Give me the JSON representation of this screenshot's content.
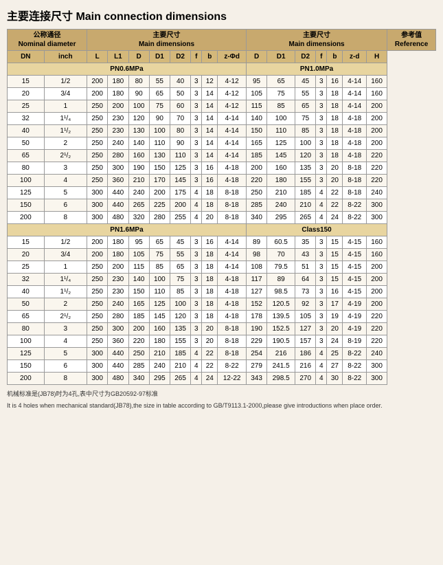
{
  "title": "主要连接尺寸 Main connection dimensions",
  "headers": {
    "nominal_diameter": "公称通径\nNominal diameter",
    "dn": "DN",
    "inch": "inch",
    "main_dimensions": "主要尺寸\nMain dimensions",
    "reference": "参考值\nReference",
    "cols_main": [
      "L",
      "L1",
      "D",
      "D1",
      "D2",
      "f",
      "b",
      "z-Φd"
    ],
    "cols_right": [
      "D",
      "D1",
      "D2",
      "f",
      "b",
      "z-d",
      "H"
    ]
  },
  "sections": [
    {
      "label": "PN0.6MPa",
      "label_right": "PN1.0MPa",
      "rows": [
        {
          "dn": "15",
          "inch": "1/2",
          "L": "200",
          "L1": "180",
          "D": "80",
          "D1": "55",
          "D2": "40",
          "f": "3",
          "b": "12",
          "zpd": "4-12",
          "D_r": "95",
          "D1_r": "65",
          "D2_r": "45",
          "f_r": "3",
          "b_r": "16",
          "zd_r": "4-14",
          "H": "160"
        },
        {
          "dn": "20",
          "inch": "3/4",
          "L": "200",
          "L1": "180",
          "D": "90",
          "D1": "65",
          "D2": "50",
          "f": "3",
          "b": "14",
          "zpd": "4-12",
          "D_r": "105",
          "D1_r": "75",
          "D2_r": "55",
          "f_r": "3",
          "b_r": "18",
          "zd_r": "4-14",
          "H": "160"
        },
        {
          "dn": "25",
          "inch": "1",
          "L": "250",
          "L1": "200",
          "D": "100",
          "D1": "75",
          "D2": "60",
          "f": "3",
          "b": "14",
          "zpd": "4-12",
          "D_r": "115",
          "D1_r": "85",
          "D2_r": "65",
          "f_r": "3",
          "b_r": "18",
          "zd_r": "4-14",
          "H": "200"
        },
        {
          "dn": "32",
          "inch": "1¹/₄",
          "L": "250",
          "L1": "230",
          "D": "120",
          "D1": "90",
          "D2": "70",
          "f": "3",
          "b": "14",
          "zpd": "4-14",
          "D_r": "140",
          "D1_r": "100",
          "D2_r": "75",
          "f_r": "3",
          "b_r": "18",
          "zd_r": "4-18",
          "H": "200"
        },
        {
          "dn": "40",
          "inch": "1¹/₂",
          "L": "250",
          "L1": "230",
          "D": "130",
          "D1": "100",
          "D2": "80",
          "f": "3",
          "b": "14",
          "zpd": "4-14",
          "D_r": "150",
          "D1_r": "110",
          "D2_r": "85",
          "f_r": "3",
          "b_r": "18",
          "zd_r": "4-18",
          "H": "200"
        },
        {
          "dn": "50",
          "inch": "2",
          "L": "250",
          "L1": "240",
          "D": "140",
          "D1": "110",
          "D2": "90",
          "f": "3",
          "b": "14",
          "zpd": "4-14",
          "D_r": "165",
          "D1_r": "125",
          "D2_r": "100",
          "f_r": "3",
          "b_r": "18",
          "zd_r": "4-18",
          "H": "200"
        },
        {
          "dn": "65",
          "inch": "2¹/₂",
          "L": "250",
          "L1": "280",
          "D": "160",
          "D1": "130",
          "D2": "110",
          "f": "3",
          "b": "14",
          "zpd": "4-14",
          "D_r": "185",
          "D1_r": "145",
          "D2_r": "120",
          "f_r": "3",
          "b_r": "18",
          "zd_r": "4-18",
          "H": "220"
        },
        {
          "dn": "80",
          "inch": "3",
          "L": "250",
          "L1": "300",
          "D": "190",
          "D1": "150",
          "D2": "125",
          "f": "3",
          "b": "16",
          "zpd": "4-18",
          "D_r": "200",
          "D1_r": "160",
          "D2_r": "135",
          "f_r": "3",
          "b_r": "20",
          "zd_r": "8-18",
          "H": "220"
        },
        {
          "dn": "100",
          "inch": "4",
          "L": "250",
          "L1": "360",
          "D": "210",
          "D1": "170",
          "D2": "145",
          "f": "3",
          "b": "16",
          "zpd": "4-18",
          "D_r": "220",
          "D1_r": "180",
          "D2_r": "155",
          "f_r": "3",
          "b_r": "20",
          "zd_r": "8-18",
          "H": "220"
        },
        {
          "dn": "125",
          "inch": "5",
          "L": "300",
          "L1": "440",
          "D": "240",
          "D1": "200",
          "D2": "175",
          "f": "4",
          "b": "18",
          "zpd": "8-18",
          "D_r": "250",
          "D1_r": "210",
          "D2_r": "185",
          "f_r": "4",
          "b_r": "22",
          "zd_r": "8-18",
          "H": "240"
        },
        {
          "dn": "150",
          "inch": "6",
          "L": "300",
          "L1": "440",
          "D": "265",
          "D1": "225",
          "D2": "200",
          "f": "4",
          "b": "18",
          "zpd": "8-18",
          "D_r": "285",
          "D1_r": "240",
          "D2_r": "210",
          "f_r": "4",
          "b_r": "22",
          "zd_r": "8-22",
          "H": "300"
        },
        {
          "dn": "200",
          "inch": "8",
          "L": "300",
          "L1": "480",
          "D": "320",
          "D1": "280",
          "D2": "255",
          "f": "4",
          "b": "20",
          "zpd": "8-18",
          "D_r": "340",
          "D1_r": "295",
          "D2_r": "265",
          "f_r": "4",
          "b_r": "24",
          "zd_r": "8-22",
          "H": "300"
        }
      ]
    },
    {
      "label": "PN1.6MPa",
      "label_right": "Class150",
      "rows": [
        {
          "dn": "15",
          "inch": "1/2",
          "L": "200",
          "L1": "180",
          "D": "95",
          "D1": "65",
          "D2": "45",
          "f": "3",
          "b": "16",
          "zpd": "4-14",
          "D_r": "89",
          "D1_r": "60.5",
          "D2_r": "35",
          "f_r": "3",
          "b_r": "15",
          "zd_r": "4-15",
          "H": "160"
        },
        {
          "dn": "20",
          "inch": "3/4",
          "L": "200",
          "L1": "180",
          "D": "105",
          "D1": "75",
          "D2": "55",
          "f": "3",
          "b": "18",
          "zpd": "4-14",
          "D_r": "98",
          "D1_r": "70",
          "D2_r": "43",
          "f_r": "3",
          "b_r": "15",
          "zd_r": "4-15",
          "H": "160"
        },
        {
          "dn": "25",
          "inch": "1",
          "L": "250",
          "L1": "200",
          "D": "115",
          "D1": "85",
          "D2": "65",
          "f": "3",
          "b": "18",
          "zpd": "4-14",
          "D_r": "108",
          "D1_r": "79.5",
          "D2_r": "51",
          "f_r": "3",
          "b_r": "15",
          "zd_r": "4-15",
          "H": "200"
        },
        {
          "dn": "32",
          "inch": "1¹/₄",
          "L": "250",
          "L1": "230",
          "D": "140",
          "D1": "100",
          "D2": "75",
          "f": "3",
          "b": "18",
          "zpd": "4-18",
          "D_r": "117",
          "D1_r": "89",
          "D2_r": "64",
          "f_r": "3",
          "b_r": "15",
          "zd_r": "4-15",
          "H": "200"
        },
        {
          "dn": "40",
          "inch": "1¹/₂",
          "L": "250",
          "L1": "230",
          "D": "150",
          "D1": "110",
          "D2": "85",
          "f": "3",
          "b": "18",
          "zpd": "4-18",
          "D_r": "127",
          "D1_r": "98.5",
          "D2_r": "73",
          "f_r": "3",
          "b_r": "16",
          "zd_r": "4-15",
          "H": "200"
        },
        {
          "dn": "50",
          "inch": "2",
          "L": "250",
          "L1": "240",
          "D": "165",
          "D1": "125",
          "D2": "100",
          "f": "3",
          "b": "18",
          "zpd": "4-18",
          "D_r": "152",
          "D1_r": "120.5",
          "D2_r": "92",
          "f_r": "3",
          "b_r": "17",
          "zd_r": "4-19",
          "H": "200"
        },
        {
          "dn": "65",
          "inch": "2¹/₂",
          "L": "250",
          "L1": "280",
          "D": "185",
          "D1": "145",
          "D2": "120",
          "f": "3",
          "b": "18",
          "zpd": "4-18",
          "D_r": "178",
          "D1_r": "139.5",
          "D2_r": "105",
          "f_r": "3",
          "b_r": "19",
          "zd_r": "4-19",
          "H": "220"
        },
        {
          "dn": "80",
          "inch": "3",
          "L": "250",
          "L1": "300",
          "D": "200",
          "D1": "160",
          "D2": "135",
          "f": "3",
          "b": "20",
          "zpd": "8-18",
          "D_r": "190",
          "D1_r": "152.5",
          "D2_r": "127",
          "f_r": "3",
          "b_r": "20",
          "zd_r": "4-19",
          "H": "220"
        },
        {
          "dn": "100",
          "inch": "4",
          "L": "250",
          "L1": "360",
          "D": "220",
          "D1": "180",
          "D2": "155",
          "f": "3",
          "b": "20",
          "zpd": "8-18",
          "D_r": "229",
          "D1_r": "190.5",
          "D2_r": "157",
          "f_r": "3",
          "b_r": "24",
          "zd_r": "8-19",
          "H": "220"
        },
        {
          "dn": "125",
          "inch": "5",
          "L": "300",
          "L1": "440",
          "D": "250",
          "D1": "210",
          "D2": "185",
          "f": "4",
          "b": "22",
          "zpd": "8-18",
          "D_r": "254",
          "D1_r": "216",
          "D2_r": "186",
          "f_r": "4",
          "b_r": "25",
          "zd_r": "8-22",
          "H": "240"
        },
        {
          "dn": "150",
          "inch": "6",
          "L": "300",
          "L1": "440",
          "D": "285",
          "D1": "240",
          "D2": "210",
          "f": "4",
          "b": "22",
          "zpd": "8-22",
          "D_r": "279",
          "D1_r": "241.5",
          "D2_r": "216",
          "f_r": "4",
          "b_r": "27",
          "zd_r": "8-22",
          "H": "300"
        },
        {
          "dn": "200",
          "inch": "8",
          "L": "300",
          "L1": "480",
          "D": "340",
          "D1": "295",
          "D2": "265",
          "f": "4",
          "b": "24",
          "zpd": "12-22",
          "D_r": "343",
          "D1_r": "298.5",
          "D2_r": "270",
          "f_r": "4",
          "b_r": "30",
          "zd_r": "8-22",
          "H": "300"
        }
      ]
    }
  ],
  "footnote1": "机械标准是(JB78)时为4孔,表中尺寸为GB20592-97标准",
  "footnote2": "It is 4 holes when mechanical standard(JB78),the size in table according to GB/T9113.1-2000,please give introductions when place order."
}
